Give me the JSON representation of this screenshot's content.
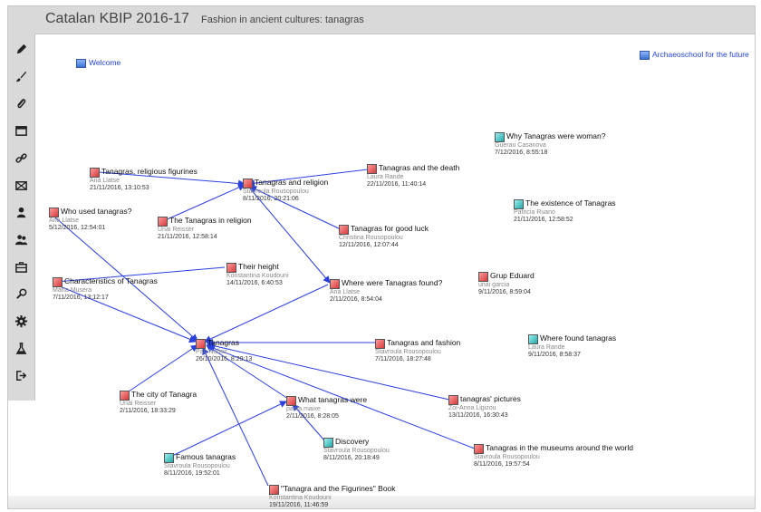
{
  "header": {
    "title": "Catalan KBIP 2016-17",
    "subtitle": "Fashion in ancient cultures: tanagras"
  },
  "sidebar": {
    "tools": [
      {
        "icon": "pencil-icon"
      },
      {
        "icon": "brush-icon"
      },
      {
        "icon": "paperclip-icon"
      },
      {
        "icon": "window-icon"
      },
      {
        "icon": "link-icon"
      },
      {
        "icon": "envelope-icon"
      },
      {
        "icon": "user-icon"
      },
      {
        "icon": "users-icon"
      },
      {
        "icon": "briefcase-icon"
      },
      {
        "icon": "magnifier-icon"
      },
      {
        "icon": "gear-icon"
      },
      {
        "icon": "flask-icon"
      },
      {
        "icon": "logout-icon"
      }
    ]
  },
  "links": {
    "welcome": "Welcome",
    "archaeoschool": "Archaeoschool for the future"
  },
  "colors": {
    "accent_red": "#d43b3b",
    "accent_teal": "#23a7a7",
    "edge_blue": "#2a3fe0",
    "link_blue": "#2244dd"
  },
  "notes": {
    "n1": {
      "title": "Tanagras, religious figurines",
      "author": "Ana Llatse",
      "date": "21/11/2016, 13:10:53",
      "color": "red"
    },
    "n2": {
      "title": "Tanagras and religion",
      "author": "Stavroula Rousopoulou",
      "date": "8/11/2016, 20:21:06",
      "color": "red"
    },
    "n3": {
      "title": "Tanagras and the death",
      "author": "Laura Rande",
      "date": "22/11/2016, 11:40:14",
      "color": "red"
    },
    "n4": {
      "title": "Why Tanagras were woman?",
      "author": "Guerau Casanova",
      "date": "7/12/2016, 8:55:18",
      "color": "teal"
    },
    "n5": {
      "title": "The existence of Tanagras",
      "author": "Patricia Ruano",
      "date": "21/11/2016, 12:58:52",
      "color": "teal"
    },
    "n6": {
      "title": "Who used tanagras?",
      "author": "Ana Llatse",
      "date": "5/12/2016, 12:54:01",
      "color": "red"
    },
    "n7": {
      "title": "The Tanagras in religion",
      "author": "Unai Reisser",
      "date": "21/11/2016, 12:58:14",
      "color": "red"
    },
    "n8": {
      "title": "Tanagras for good luck",
      "author": "Christina Rousopoulou",
      "date": "12/11/2016, 12:07:44",
      "color": "red"
    },
    "n9": {
      "title": "Their height",
      "author": "Konstantina Koudouni",
      "date": "14/11/2016, 6:40:53",
      "color": "red"
    },
    "n10": {
      "title": "Characteristics of Tanagras",
      "author": "Marta Musera",
      "date": "7/11/2016, 13:12:17",
      "color": "red"
    },
    "n11": {
      "title": "Where were Tanagras found?",
      "author": "Ana Llatse",
      "date": "2/11/2016, 8:54:04",
      "color": "red"
    },
    "n12": {
      "title": "Grup Eduard",
      "author": "unai garcia",
      "date": "9/11/2016, 8:59:04",
      "color": "red"
    },
    "n13": {
      "title": "Where found tanagras",
      "author": "Laura Rande",
      "date": "9/11/2016, 8:58:37",
      "color": "teal"
    },
    "n14": {
      "title": "Tanagras",
      "author": "Pau Nuñez",
      "date": "26/10/2016, 8:29:13",
      "color": "red"
    },
    "n15": {
      "title": "Tanagras and fashion",
      "author": "Stavroula Rousopoulou",
      "date": "7/11/2016, 18:27:48",
      "color": "red"
    },
    "n16": {
      "title": "The city of Tanagra",
      "author": "Unai Reisser",
      "date": "2/11/2016, 18:33:29",
      "color": "red"
    },
    "n17": {
      "title": "What tanagras were",
      "author": "paula maixe",
      "date": "2/11/2016, 8:28:05",
      "color": "red"
    },
    "n18": {
      "title": "tanagras' pictures",
      "author": "Zoi-Anna Ligizou",
      "date": "13/11/2016, 16:30:43",
      "color": "red"
    },
    "n19": {
      "title": "Discovery",
      "author": "Stavroula Rousopoulou",
      "date": "8/11/2016, 20:18:49",
      "color": "teal"
    },
    "n20": {
      "title": "Famous tanagras",
      "author": "Stavroula Rousopoulou",
      "date": "8/11/2016, 19:52:01",
      "color": "teal"
    },
    "n21": {
      "title": "Tanagras in the museums around the world",
      "author": "Stavroula Rousopoulou",
      "date": "8/11/2016, 19:57:54",
      "color": "red"
    },
    "n22": {
      "title": "\"Tanagra and the Figurines\" Book",
      "author": "Konstantina Koudouni",
      "date": "19/11/2016, 11:46:59",
      "color": "red"
    }
  }
}
